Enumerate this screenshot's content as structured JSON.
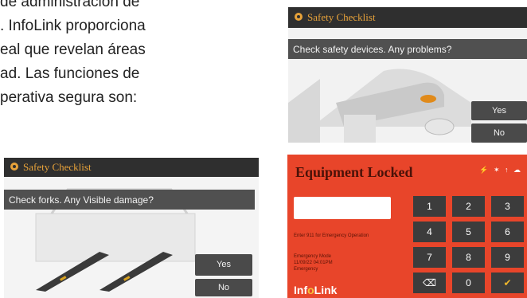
{
  "body_text": [
    "de administración de",
    ". InfoLink proporciona",
    "eal que revelan áreas",
    "ad. Las funciones de",
    "perativa segura son:"
  ],
  "screen1": {
    "title": "Safety Checklist",
    "question": "Check safety devices. Any problems?",
    "yes": "Yes",
    "no": "No"
  },
  "screen2": {
    "title": "Safety Checklist",
    "question": "Check forks. Any Visible damage?",
    "yes": "Yes",
    "no": "No"
  },
  "screen3": {
    "title": "Equipment Locked",
    "status": "⚡ ✶ ↑ ☁",
    "hint": "Enter 911 for Emergency Operation",
    "emergency_mode": "Emergency Mode",
    "date": "11/09/22 04:01PM",
    "emergency": "Emergency",
    "logo_pre": "Inf",
    "logo_o": "o",
    "logo_post": "Link",
    "keys": [
      "1",
      "2",
      "3",
      "4",
      "5",
      "6",
      "7",
      "8",
      "9",
      "⌫",
      "0",
      "✔"
    ]
  },
  "colors": {
    "accent": "#e7a23a",
    "lock_bg": "#e8452a"
  }
}
